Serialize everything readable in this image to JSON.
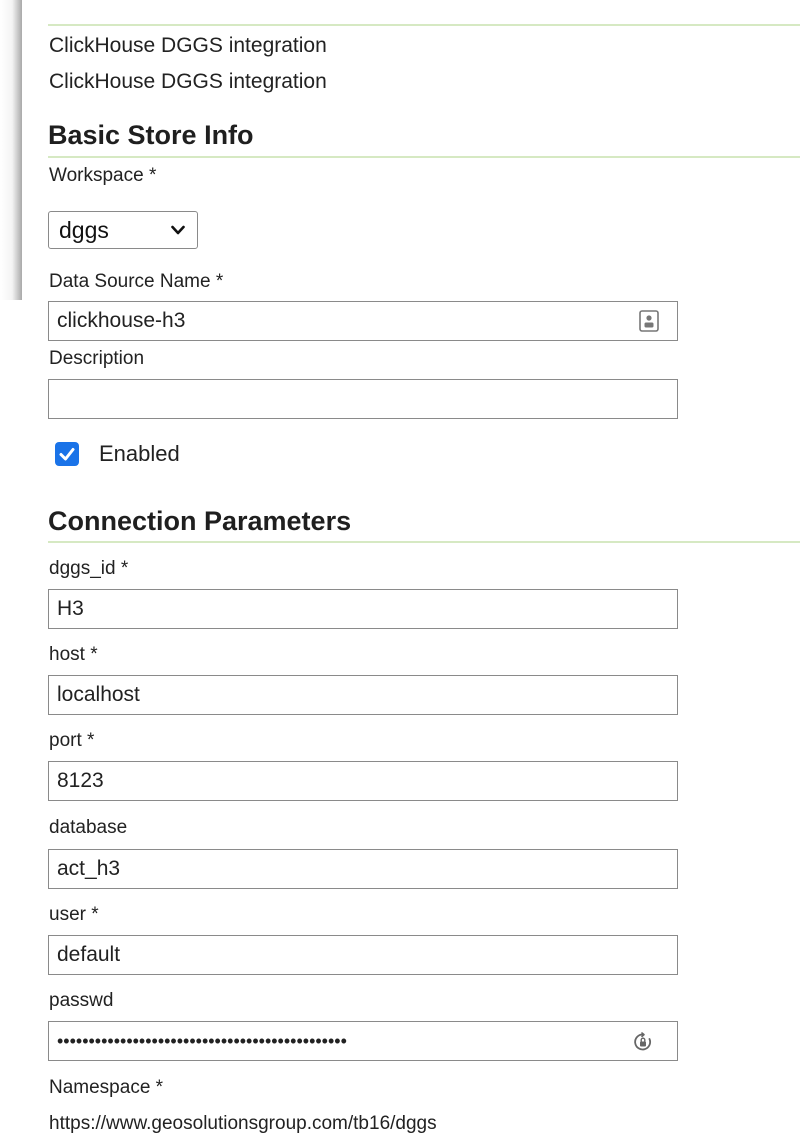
{
  "header": {
    "line1": "ClickHouse DGGS integration",
    "line2": "ClickHouse DGGS integration"
  },
  "basic_info": {
    "title": "Basic Store Info",
    "workspace_label": "Workspace *",
    "workspace_value": "dggs",
    "datasource_label": "Data Source Name *",
    "datasource_value": "clickhouse-h3",
    "description_label": "Description",
    "description_value": "",
    "enabled_label": "Enabled",
    "enabled_checked": true
  },
  "connection": {
    "title": "Connection Parameters",
    "dggs_id_label": "dggs_id *",
    "dggs_id_value": "H3",
    "host_label": "host *",
    "host_value": "localhost",
    "port_label": "port *",
    "port_value": "8123",
    "database_label": "database",
    "database_value": "act_h3",
    "user_label": "user *",
    "user_value": "default",
    "passwd_label": "passwd",
    "passwd_value": "••••••••••••••••••••••••••••••••••••••••••••••",
    "namespace_label": "Namespace *",
    "namespace_value": "https://www.geosolutionsgroup.com/tb16/dggs"
  },
  "colors": {
    "section_rule": "#d6e9c3",
    "checkbox": "#1a73e8"
  },
  "icons": {
    "select_arrow": "chevron-down-icon",
    "datasource_field": "contact-card-icon",
    "password_field": "password-manager-icon"
  }
}
